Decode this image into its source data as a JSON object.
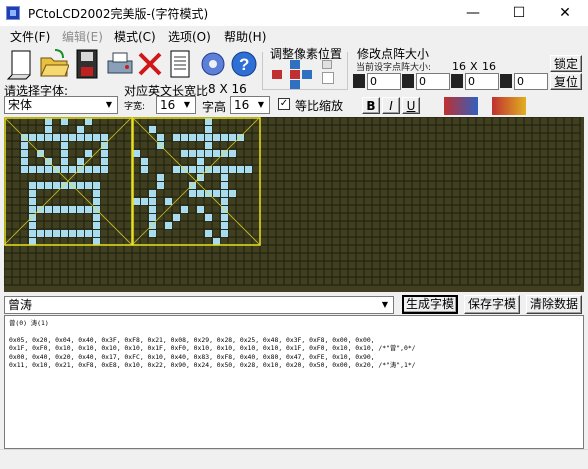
{
  "window": {
    "title": "PCtoLCD2002完美版-(字符模式)",
    "controls": {
      "minimize": "—",
      "maximize": "☐",
      "close": "✕"
    }
  },
  "menu": {
    "items": [
      {
        "label": "文件(F)",
        "disabled": false
      },
      {
        "label": "编辑(E)",
        "disabled": true
      },
      {
        "label": "模式(C)",
        "disabled": false
      },
      {
        "label": "选项(O)",
        "disabled": false
      },
      {
        "label": "帮助(H)",
        "disabled": false
      }
    ]
  },
  "pixel_adjust": {
    "label": "调整像素位置"
  },
  "dot_size": {
    "label": "修改点阵大小",
    "current_label": "当前设字点阵大小:",
    "width": "16",
    "x": "X",
    "height": "16",
    "lock_button": "锁定",
    "restore_button": "复位",
    "spin_values": [
      "0",
      "0",
      "0",
      "0"
    ]
  },
  "font": {
    "select_label": "请选择字体:",
    "font_name": "宋体",
    "ascii_width_label": "对应英文长宽比",
    "ascii_width_value": "8 X 16",
    "width_label": "字宽:",
    "width_value": "16",
    "height_label": "字高",
    "height_value": "16",
    "scale_label": "等比缩放",
    "scale_checked": true,
    "bold": "B",
    "italic": "I",
    "underline": "U"
  },
  "grid": {
    "background_color": "#404020",
    "line_color": "#1e1e0e",
    "pixel_on_color": "#a8dcf0",
    "selection_color": "#e8e020",
    "characters": [
      "曾",
      "涛"
    ]
  },
  "input": {
    "text": "曾涛",
    "generate_button": "生成字模",
    "save_button": "保存字模",
    "clear_button": "清除数据"
  },
  "output": {
    "header": "曾(0) 涛(1)",
    "lines": [
      "0x05, 0x20, 0x04, 0x40, 0x3F, 0xF8, 0x21, 0x08, 0x29, 0x28, 0x25, 0x48, 0x3F, 0xF8, 0x00, 0x00,",
      "0x1F, 0xF0, 0x10, 0x10, 0x10, 0x10, 0x1F, 0xF0, 0x10, 0x10, 0x10, 0x10, 0x1F, 0xF0, 0x10, 0x10, /*\"曾\",0*/",
      "0x00, 0x40, 0x20, 0x40, 0x17, 0xFC, 0x10, 0x40, 0x83, 0xF8, 0x40, 0x80, 0x47, 0xFE, 0x10, 0x90,",
      "0x11, 0x10, 0x21, 0xF8, 0xE8, 0x10, 0x22, 0x90, 0x24, 0x50, 0x28, 0x10, 0x20, 0x50, 0x00, 0x20, /*\"涛\",1*/"
    ]
  }
}
